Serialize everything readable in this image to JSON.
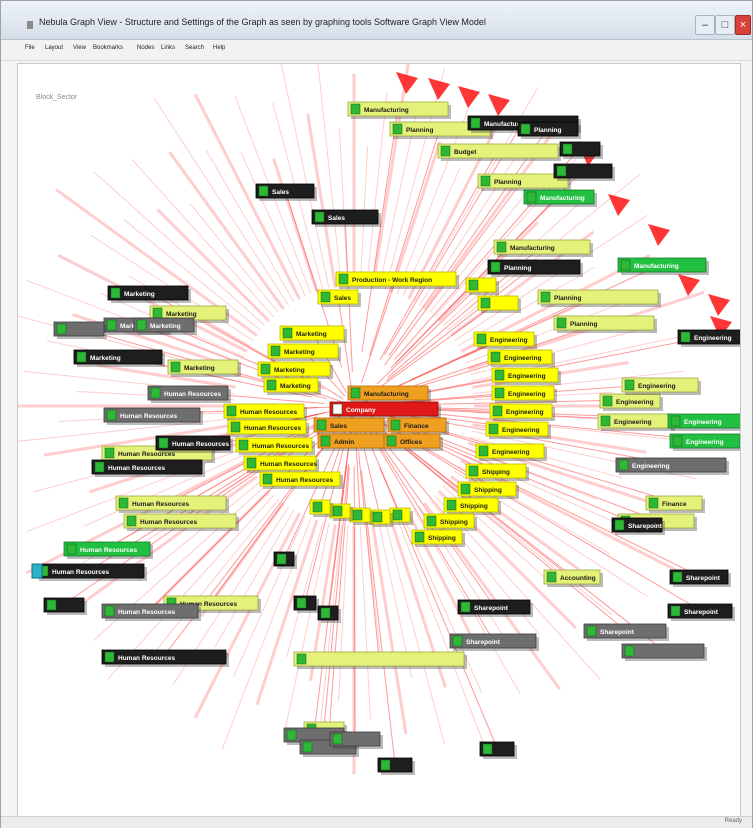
{
  "window": {
    "title": "Nebula Graph View - Structure and Settings of the Graph as seen by graphing tools Software Graph View Model"
  },
  "menu": [
    "File",
    "Layout",
    "View",
    "Bookmarks",
    "Nodes",
    "Links",
    "Search",
    "Help"
  ],
  "canvas": {
    "label": "Block_Sector"
  },
  "status": {
    "text": "Ready"
  },
  "colors": {
    "core": "#f0a020",
    "ring": "#ffff00",
    "light": "#e4f27a",
    "green": "#22c040",
    "dark": "#1e1e1e",
    "gray": "#6e6e6e",
    "edge": "#ff2020",
    "focus": "#e01818",
    "badge": "#2fb836",
    "cyan": "#2cb2c8"
  },
  "labels": {
    "manufacturing": "Manufacturing",
    "production": "Production - Work Region",
    "sales": "Sales",
    "marketing": "Marketing",
    "engineering": "Engineering",
    "hr": "Human Resources",
    "finance": "Finance",
    "sharepoint": "Sharepoint",
    "admin": "Admin",
    "offices": "Offices",
    "shipping": "Shipping",
    "budget": "Budget",
    "planning": "Planning",
    "accounting": "Accounting",
    "default": "Company"
  }
}
